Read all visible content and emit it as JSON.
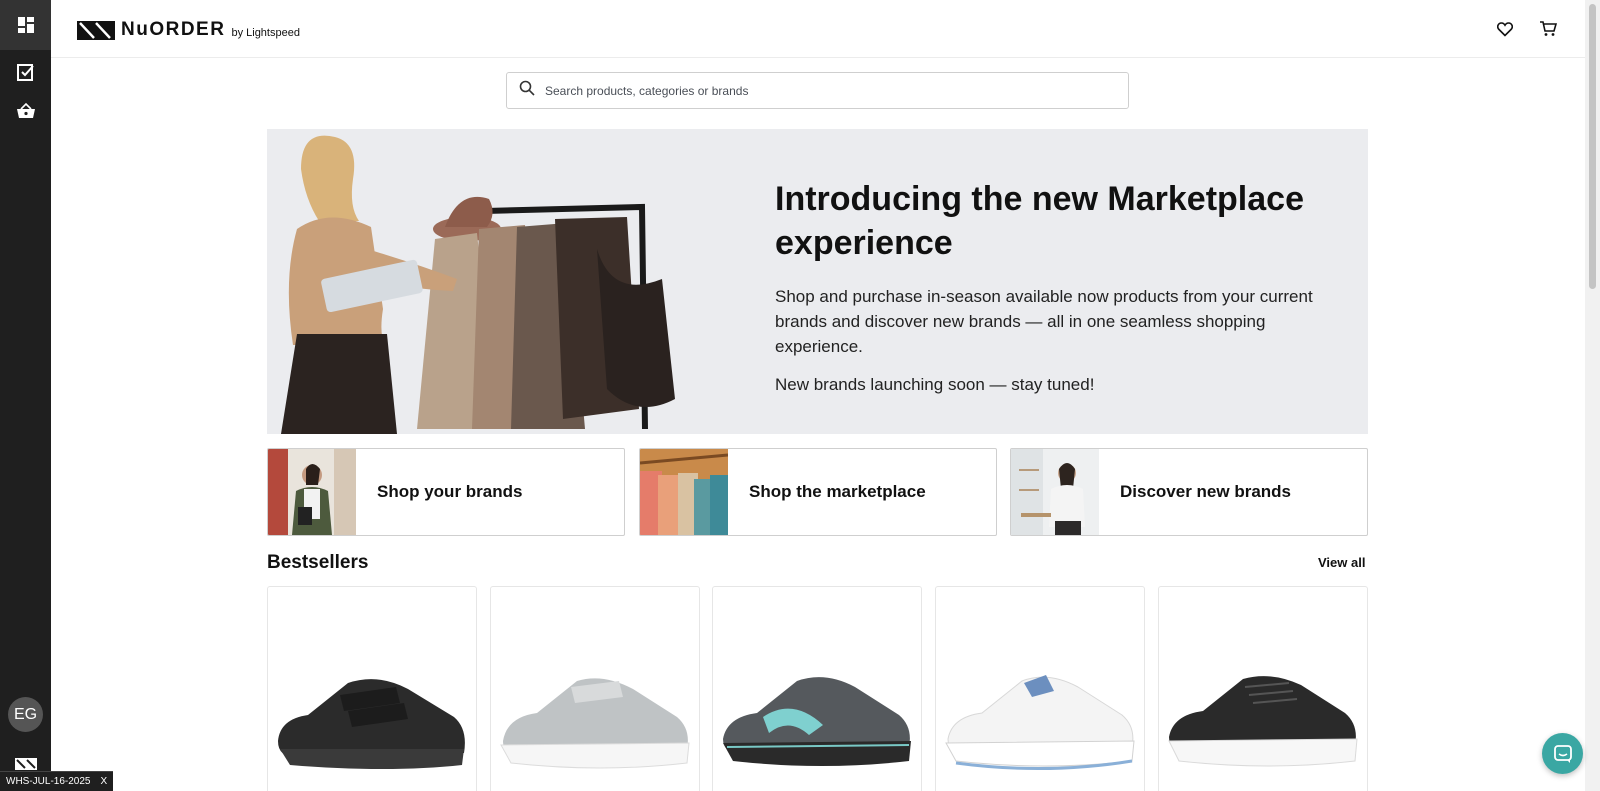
{
  "app": {
    "brand_name": "NuORDER",
    "brand_suffix": "by Lightspeed",
    "user_initials": "EG"
  },
  "env_badge": {
    "label": "WHS-JUL-16-2025",
    "close": "X"
  },
  "search": {
    "placeholder": "Search products, categories or brands"
  },
  "hero": {
    "title": "Introducing the new Marketplace experience",
    "body": "Shop and purchase in-season available now products from your current brands and discover new brands — all in one seamless shopping experience.",
    "note": "New brands launching soon — stay tuned!"
  },
  "categories": [
    {
      "label": "Shop your brands"
    },
    {
      "label": "Shop the marketplace"
    },
    {
      "label": "Discover new brands"
    }
  ],
  "bestsellers": {
    "title": "Bestsellers",
    "view_all": "View all"
  },
  "products": [
    {
      "name": "black-velcro-sneaker",
      "color": "#2b2b2b"
    },
    {
      "name": "grey-strap-sneaker",
      "color": "#bfc3c5"
    },
    {
      "name": "grey-teal-strap-sneaker",
      "color": "#55595d"
    },
    {
      "name": "white-blue-sneaker",
      "color": "#f4f4f4"
    },
    {
      "name": "black-lace-sneaker",
      "color": "#2a2a2a"
    }
  ],
  "colors": {
    "rail": "#1f1f1f",
    "hero_bg": "#ebecef",
    "chat": "#3aa7a3"
  }
}
